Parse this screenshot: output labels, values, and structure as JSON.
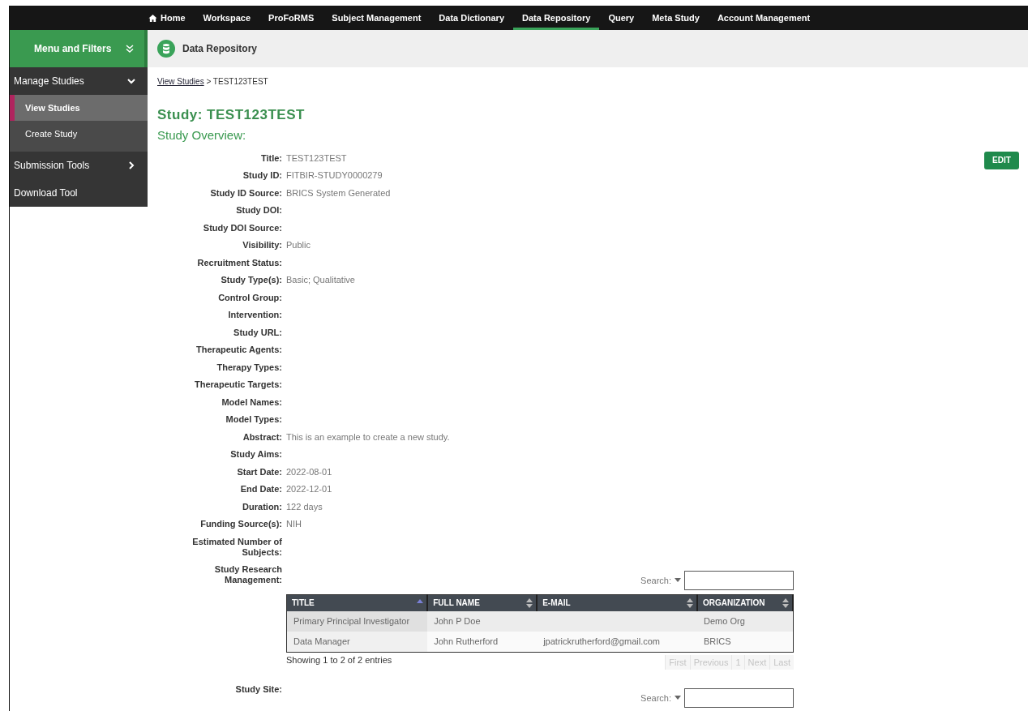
{
  "nav": {
    "items": [
      {
        "label": "Home",
        "kind": "icon-link",
        "selected": false
      },
      {
        "label": "Workspace",
        "kind": "link",
        "selected": false
      },
      {
        "label": "ProFoRMS",
        "kind": "link",
        "selected": false
      },
      {
        "label": "Subject Management",
        "kind": "link",
        "selected": false
      },
      {
        "label": "Data Dictionary",
        "kind": "link",
        "selected": false
      },
      {
        "label": "Data Repository",
        "kind": "link",
        "selected": true
      },
      {
        "label": "Query",
        "kind": "link",
        "selected": false
      },
      {
        "label": "Meta Study",
        "kind": "link",
        "selected": false
      },
      {
        "label": "Account Management",
        "kind": "link",
        "selected": false
      }
    ]
  },
  "sidebar": {
    "title": "Menu and Filters",
    "sections": [
      {
        "label": "Manage Studies",
        "kind": "group",
        "expanded": true,
        "children": [
          {
            "label": "View Studies",
            "selected": true
          },
          {
            "label": "Create Study",
            "selected": false
          }
        ]
      },
      {
        "label": "Submission Tools",
        "kind": "group",
        "expanded": false
      },
      {
        "label": "Download Tool",
        "kind": "link"
      }
    ]
  },
  "page_header": {
    "title": "Data Repository"
  },
  "breadcrumb": {
    "link": "View Studies",
    "separator": ">",
    "current": "TEST123TEST"
  },
  "study_title": "Study: TEST123TEST",
  "section_title": "Study Overview:",
  "edit_button": "EDIT",
  "fields": [
    {
      "label": "Title:",
      "value": "TEST123TEST"
    },
    {
      "label": "Study ID:",
      "value": "FITBIR-STUDY0000279"
    },
    {
      "label": "Study ID Source:",
      "value": "BRICS System Generated"
    },
    {
      "label": "Study DOI:"
    },
    {
      "label": "Study DOI Source:"
    },
    {
      "label": "Visibility:",
      "value": "Public"
    },
    {
      "label": "Recruitment Status:"
    },
    {
      "label": "Study Type(s):",
      "value": "Basic; Qualitative"
    },
    {
      "label": "Control Group:"
    },
    {
      "label": "Intervention:"
    },
    {
      "label": "Study URL:"
    },
    {
      "label": "Therapeutic Agents:"
    },
    {
      "label": "Therapy Types:"
    },
    {
      "label": "Therapeutic Targets:"
    },
    {
      "label": "Model Names:"
    },
    {
      "label": "Model Types:"
    },
    {
      "label": "Abstract:",
      "value": "This is an example to create a new study."
    },
    {
      "label": "Study Aims:"
    },
    {
      "label": "Start Date:",
      "value": "2022-08-01"
    },
    {
      "label": "End Date:",
      "value": "2022-12-01"
    },
    {
      "label": "Duration:",
      "value": "122 days"
    },
    {
      "label": "Funding Source(s):",
      "value": "NIH"
    },
    {
      "label": "Estimated Number of Subjects:"
    }
  ],
  "research_management": {
    "label": "Study Research Management:",
    "search_label": "Search:",
    "columns": [
      {
        "label": "TITLE",
        "sorted": true
      },
      {
        "label": "FULL NAME",
        "sorted": false
      },
      {
        "label": "E-MAIL",
        "sorted": false
      },
      {
        "label": "ORGANIZATION",
        "sorted": false
      }
    ],
    "rows": [
      {
        "title": "Primary Principal Investigator",
        "full_name": "John P Doe",
        "organization": "Demo Org"
      },
      {
        "title": "Data Manager",
        "full_name": "John Rutherford",
        "email": "jpatrickrutherford@gmail.com",
        "organization": "BRICS"
      }
    ],
    "info": "Showing 1 to 2 of 2 entries",
    "pagination": [
      {
        "label": "First",
        "disabled": true
      },
      {
        "label": "Previous",
        "disabled": true
      },
      {
        "label": "1",
        "disabled": true
      },
      {
        "label": "Next",
        "disabled": true
      },
      {
        "label": "Last",
        "disabled": true
      }
    ]
  },
  "study_site": {
    "label": "Study Site:",
    "search_label": "Search:"
  }
}
